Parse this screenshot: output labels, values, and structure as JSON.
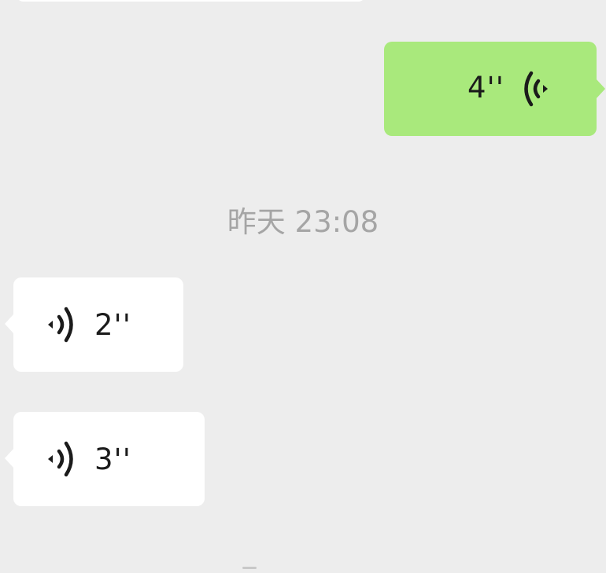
{
  "chat": {
    "messages": [
      {
        "side": "sent",
        "type": "voice",
        "duration": "4''",
        "icon": "voice-playback-icon"
      },
      {
        "side": "received",
        "type": "voice",
        "duration": "2''",
        "icon": "voice-playback-icon"
      },
      {
        "side": "received",
        "type": "voice",
        "duration": "3''",
        "icon": "voice-playback-icon"
      }
    ],
    "timestamp": "昨天 23:08"
  },
  "colors": {
    "background": "#ededed",
    "sent_bubble": "#a9e97c",
    "received_bubble": "#ffffff",
    "timestamp_text": "#a5a5a5",
    "duration_text": "#1b1b1b"
  }
}
